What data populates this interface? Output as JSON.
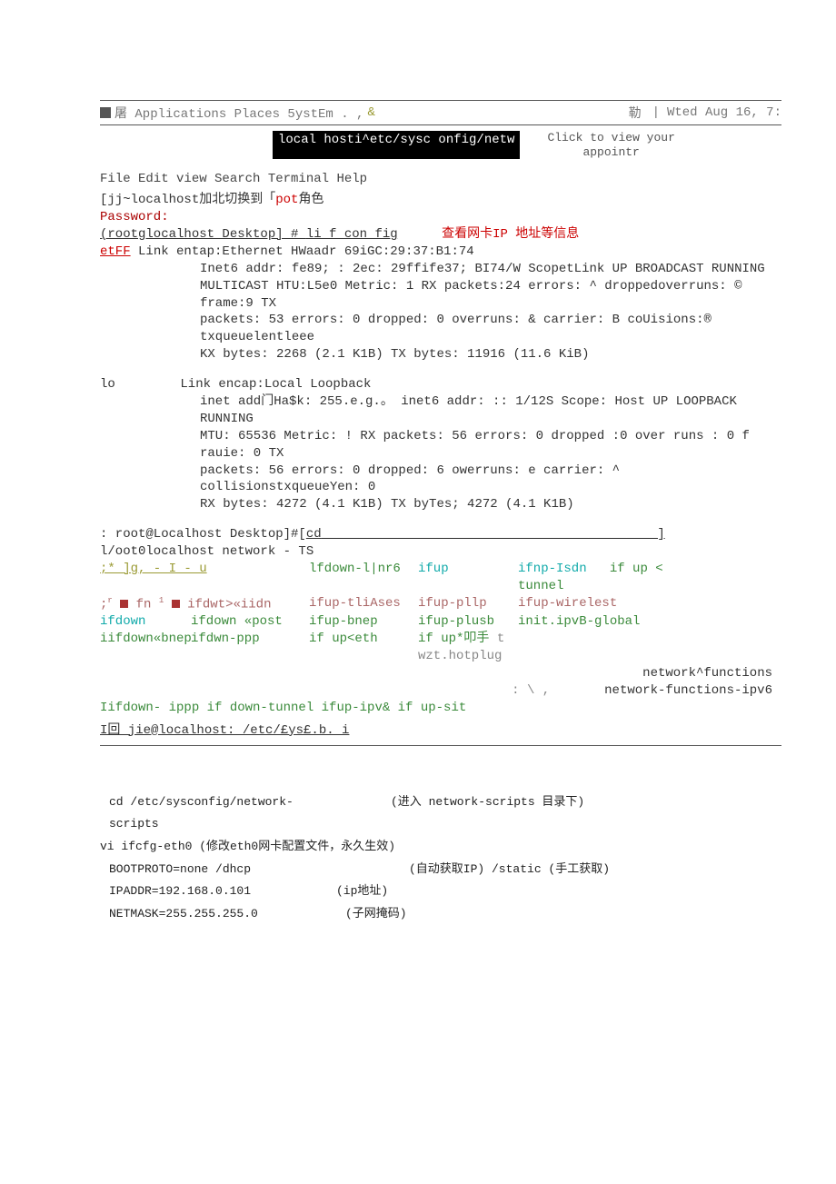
{
  "topbar": {
    "left": "屠 Applications Places 5ystEm .  , ",
    "amp": "&",
    "right1": "勒",
    "sep": "|",
    "date": "Wted Aug 16, 7:"
  },
  "title_black": "local hosti^etc/sysc onfig/netw",
  "appoint_l1": "Click to view your",
  "appoint_l2": "appointr",
  "menu": "File Edit view Search Terminal Help",
  "line_jj_pre": "[jj~localhost加北切换到「",
  "line_jj_pot": "pot",
  "line_jj_suf": "角色",
  "password": "Password:",
  "root_prompt": "(rootglocalhost Desktop] # ",
  "ifconfig": "li f con fig",
  "ifconfig_note": "查看网卡IP 地址等信息",
  "etff": "etFF",
  "etff_rest": " Link entap:Ethernet HWaadr 69iGC:29:37:B1:74",
  "eth_l1": "Inet6 addr:  fe89; : 2ec: 29ffife37; BI74/W ScopetLink UP BROADCAST RUNNING",
  "eth_l2": "MULTICAST HTU:L5e0 Metric: 1 RX packets:24 errors: ^ droppedoverruns: © frame:9 TX",
  "eth_l3": "packets: 53 errors: 0 dropped: 0 overruns: & carrier: B coUisions:® txqueuelentleee",
  "eth_l4": "KX bytes: 2268 (2.1 K1B) TX bytes: 11916 (11.6 KiB)",
  "lo": "lo",
  "lo_head": "Link encap:Local Loopback",
  "lo_l1": "inet add门Ha$k: 255.e.g.。  inet6 addr:  :: 1/12S Scope: Host UP LOOPBACK RUNNING",
  "lo_l2": "MTU: 65536 Metric: ! RX packets: 56 errors: 0 dropped :0 over runs : 0 f rauie: 0 TX",
  "lo_l3": "packets: 56 errors: 0 dropped: 6 owerruns: e carrier: ^ collisionstxqueueYen: 0",
  "lo_l4": "RX bytes: 4272 (4.1 K1B) TX byTes; 4272 (4.1 K1B)",
  "cd_pre": ": root@Localhost Desktop]#[",
  "cd": "cd",
  "cd_under": "____________________________________________]",
  "ls_line": "l/oot0localhost network -          TS",
  "row1_c1": ";* ]g, - I - u",
  "row1_c2": "lfdown-l|nr6",
  "row1_c3": "ifup",
  "row1_c4": "ifnp-Isdn",
  "row1_c5": "if up < tunnel",
  "row2_c1a": ";",
  "row2_c1b": " fn ",
  "row2_c1c": " ifdwt>«iidn",
  "row2_c2": "ifup-tliAses",
  "row2_c3": "ifup-pllp",
  "row2_c4": "ifup-wirelest",
  "row3_c1": "ifdown",
  "row3_c2": "ifdown «post",
  "row3_c3": "ifup-bnep",
  "row3_c4": "ifup-plusb",
  "row3_c5": "init.ipvB-global",
  "row4_c1": "iifdown«bnep",
  "row4_c2": "ifdwn-ppp",
  "row4_c3": "if up<eth",
  "row4_c4": "if up*叩手",
  "row4_c5": "t  wzt.hotplug",
  "nf1": "network^functions",
  "nf_sep": ": \\ ,",
  "nf2": "network-functions-ipv6",
  "green_last": "Iifdown- ippp if down-tunnel ifup-ipv& if up-sit",
  "bottom_line": "  I回 jie@localhost: /etc/£ys£.b. i",
  "notes": {
    "l1a": "cd /etc/sysconfig/network-scripts",
    "l1b": "(进入 network-scripts 目录下)",
    "l2": "vi ifcfg-eth0  (修改eth0网卡配置文件，永久生效)",
    "l3a": "BOOTPROTO=none /dhcp",
    "l3b": "(自动获取IP) /static (手工获取)",
    "l4a": "IPADDR=192.168.0.101",
    "l4b": "(ip地址)",
    "l5a": "NETMASK=255.255.255.0",
    "l5b": "(子网掩码)"
  }
}
